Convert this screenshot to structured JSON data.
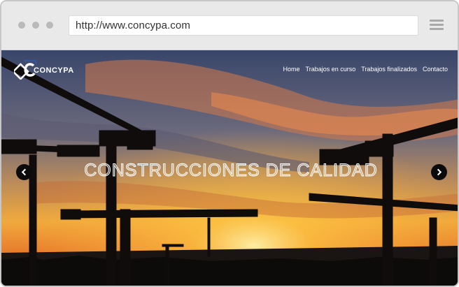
{
  "browser": {
    "url": "http://www.concypa.com",
    "menu_icon": "hamburger-menu-icon",
    "window_dots": [
      "dot",
      "dot",
      "dot"
    ]
  },
  "site": {
    "logo_text": "CONCYPA",
    "nav": [
      {
        "label": "Home"
      },
      {
        "label": "Trabajos en curso"
      },
      {
        "label": "Trabajos finalizados"
      },
      {
        "label": "Contacto"
      }
    ],
    "hero_title": "CONSTRUCCIONES DE CALIDAD",
    "prev_icon": "chevron-left-icon",
    "next_icon": "chevron-right-icon"
  },
  "colors": {
    "sky_top": "#3f4b6a",
    "sunset": "#f1b23b",
    "cloud": "#e06a3b",
    "ground": "#0b0b0b"
  }
}
